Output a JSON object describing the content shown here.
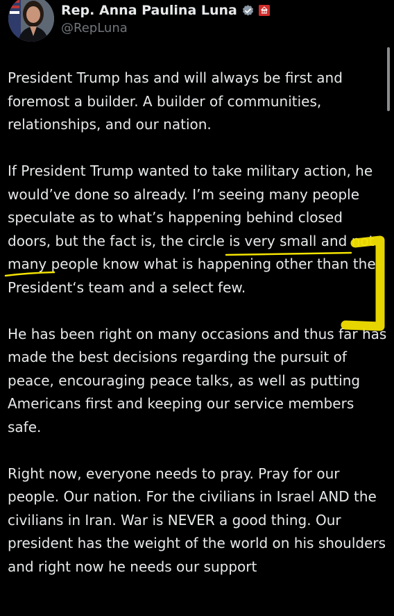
{
  "author": {
    "display_name": "Rep. Anna Paulina Luna",
    "handle": "@RepLuna",
    "verified_icon": "verified-badge-icon",
    "affiliation_icon": "house-seal-icon"
  },
  "post": {
    "paragraphs": [
      "President Trump has and will always be first and foremost a builder. A builder of communities, relationships, and our nation.",
      "If President Trump wanted to take military action, he would’ve done so already. I’m seeing many people speculate as to what’s happening behind closed doors, but the fact is, the circle is very small and not many people know what is happening other than the President‘s team and a select few.",
      "He has been right on many occasions and thus far has made the best decisions regarding the pursuit of peace, encouraging peace talks, as well as putting Americans first and keeping our service members safe.",
      "Right now, everyone needs to pray. Pray for our people. Our nation. For the civilians in Israel AND the civilians in Iran. War is NEVER a good thing. Our president has the weight of the world on his shoulders and right now he needs our support"
    ]
  },
  "colors": {
    "background": "#000000",
    "text": "#e7e9ea",
    "secondary_text": "#71767b",
    "verified_blue": "#1d9bf0",
    "highlight_yellow": "#f5e400"
  }
}
